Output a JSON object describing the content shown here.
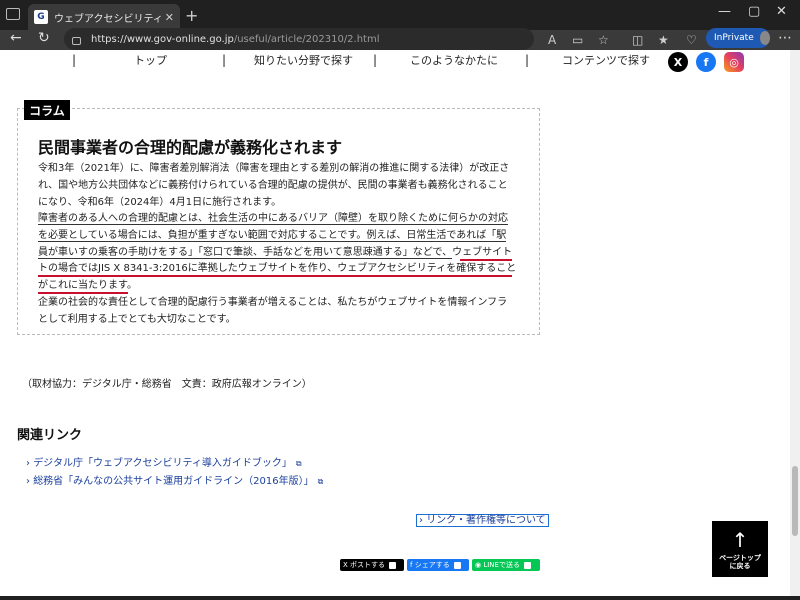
{
  "browser": {
    "tab_title": "ウェブアクセシビリティ | 暮らしに役立つ",
    "url_host": "https://www.gov-online.go.jp",
    "url_path": "/useful/article/202310/2.html",
    "inprivate_label": "InPrivate"
  },
  "nav": {
    "items": [
      "トップ",
      "知りたい分野で探す",
      "このようなかたに",
      "コンテンツで探す"
    ]
  },
  "column": {
    "tag": "コラム",
    "title": "民間事業者の合理的配慮が義務化されます",
    "lines": [
      "令和3年（2021年）に、障害者差別解消法（障害を理由とする差別の解消の推進に関する法律）が改正さ",
      "れ、国や地方公共団体などに義務付けられている合理的配慮の提供が、民間の事業者も義務化されること",
      "になり、令和6年（2024年）4月1日に施行されます。",
      "障害者のある人への合理的配慮とは、社会生活の中にあるバリア（障壁）を取り除くために何らかの対応",
      "を必要としている場合には、負担が重すぎない範囲で対応することです。例えば、日常生活であれば「駅",
      "員が車いすの乗客の手助けをする」「窓口で筆談、手話などを用いて意思疎通する」などで、",
      "ウェブサイト",
      "トの場合ではJIS X 8341-3:2016に準拠したウェブサイトを作り、ウェブアクセシビリティを確保すること",
      "がこれに当たります。",
      "企業の社会的な責任として合理的配慮行う事業者が増えることは、私たちがウェブサイトを情報インフラ",
      "として利用する上でとても大切なことです。"
    ]
  },
  "credit": "（取材協力：デジタル庁・総務省　文責：政府広報オンライン）",
  "related": {
    "heading": "関連リンク",
    "links": [
      "デジタル庁「ウェブアクセシビリティ導入ガイドブック」",
      "総務省「みんなの公共サイト運用ガイドライン（2016年版）」"
    ]
  },
  "copyright_link": "リンク・著作権等について",
  "page_top": {
    "line1": "ページトップ",
    "line2": "に戻る"
  },
  "share": {
    "x": "ポストする",
    "facebook": "シェアする",
    "line": "LINEで送る"
  }
}
